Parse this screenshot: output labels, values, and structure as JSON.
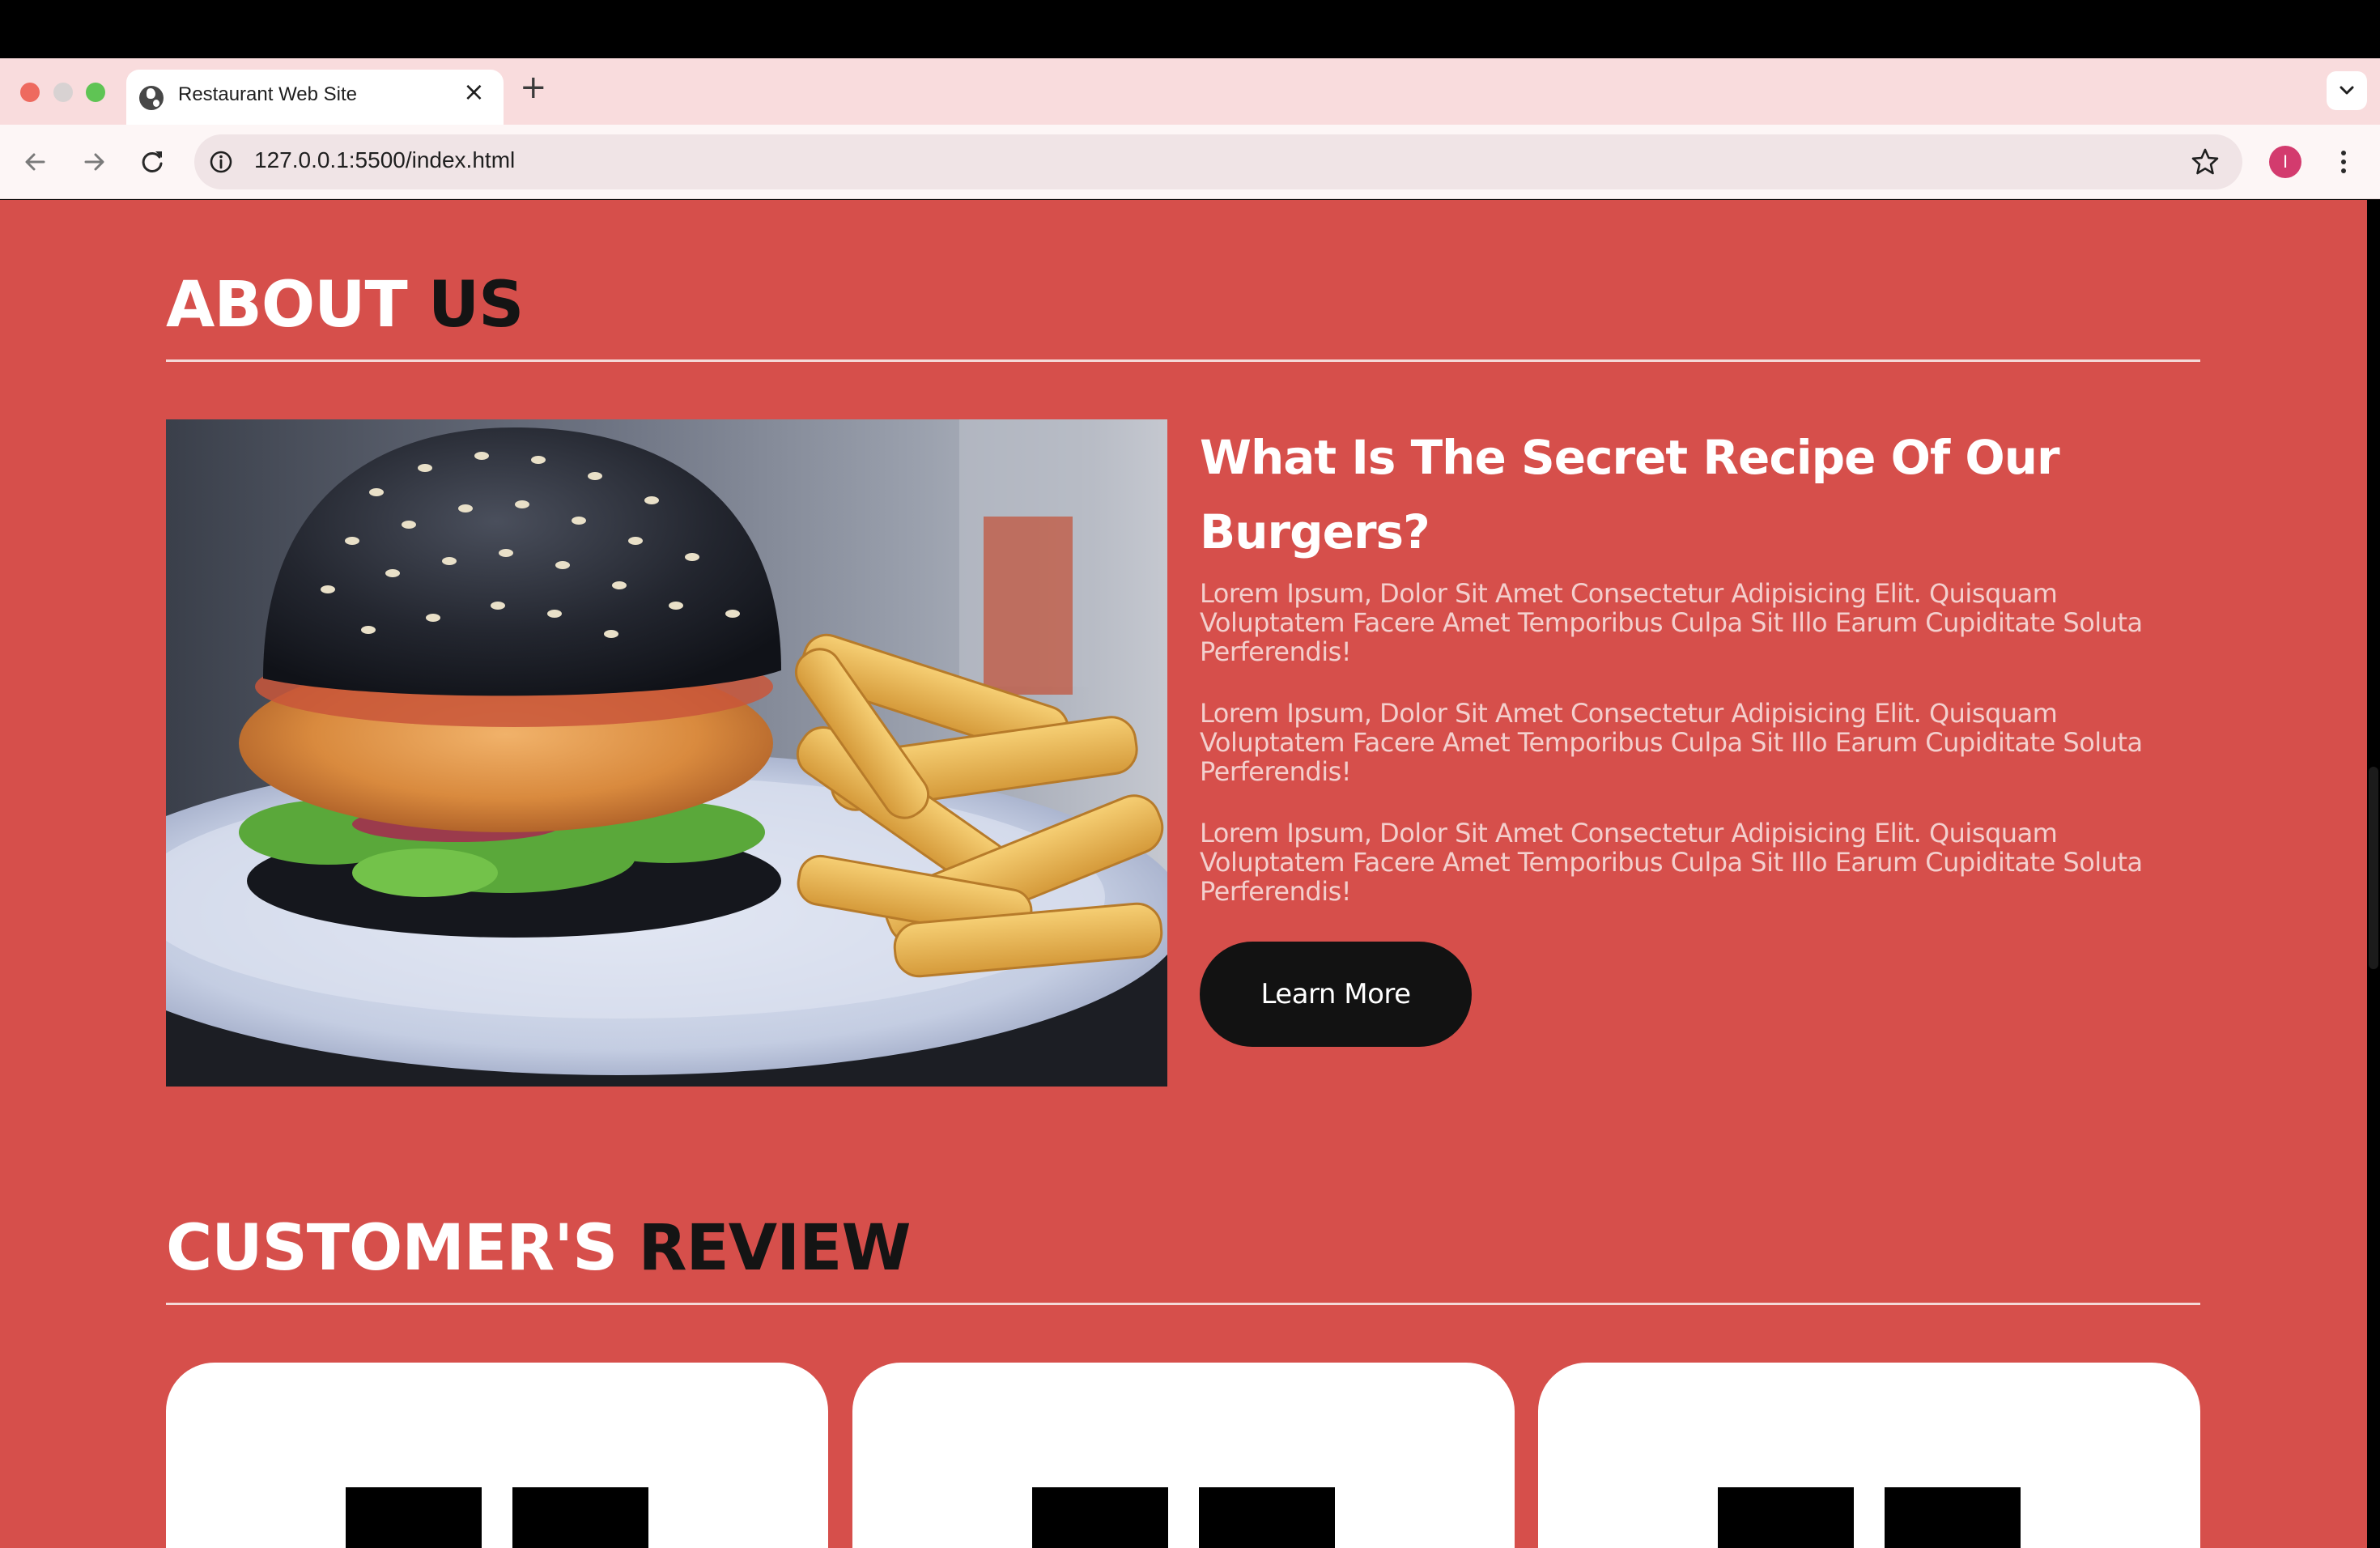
{
  "browser": {
    "tab_title": "Restaurant Web Site",
    "url": "127.0.0.1:5500/index.html",
    "profile_initial": "I"
  },
  "about": {
    "heading_white": "ABOUT",
    "heading_dark": "US",
    "title": "What Is The Secret Recipe Of Our Burgers?",
    "paragraphs": [
      "Lorem Ipsum, Dolor Sit Amet Consectetur Adipisicing Elit. Quisquam Voluptatem Facere Amet Temporibus Culpa Sit Illo Earum Cupiditate Soluta Perferendis!",
      "Lorem Ipsum, Dolor Sit Amet Consectetur Adipisicing Elit. Quisquam Voluptatem Facere Amet Temporibus Culpa Sit Illo Earum Cupiditate Soluta Perferendis!",
      "Lorem Ipsum, Dolor Sit Amet Consectetur Adipisicing Elit. Quisquam Voluptatem Facere Amet Temporibus Culpa Sit Illo Earum Cupiditate Soluta Perferendis!"
    ],
    "button_label": "Learn More"
  },
  "review": {
    "heading_white": "CUSTOMER'S",
    "heading_dark": "REVIEW"
  },
  "colors": {
    "page_bg": "#d64f4b",
    "heading_accent": "#141414",
    "button_bg": "#121212"
  }
}
